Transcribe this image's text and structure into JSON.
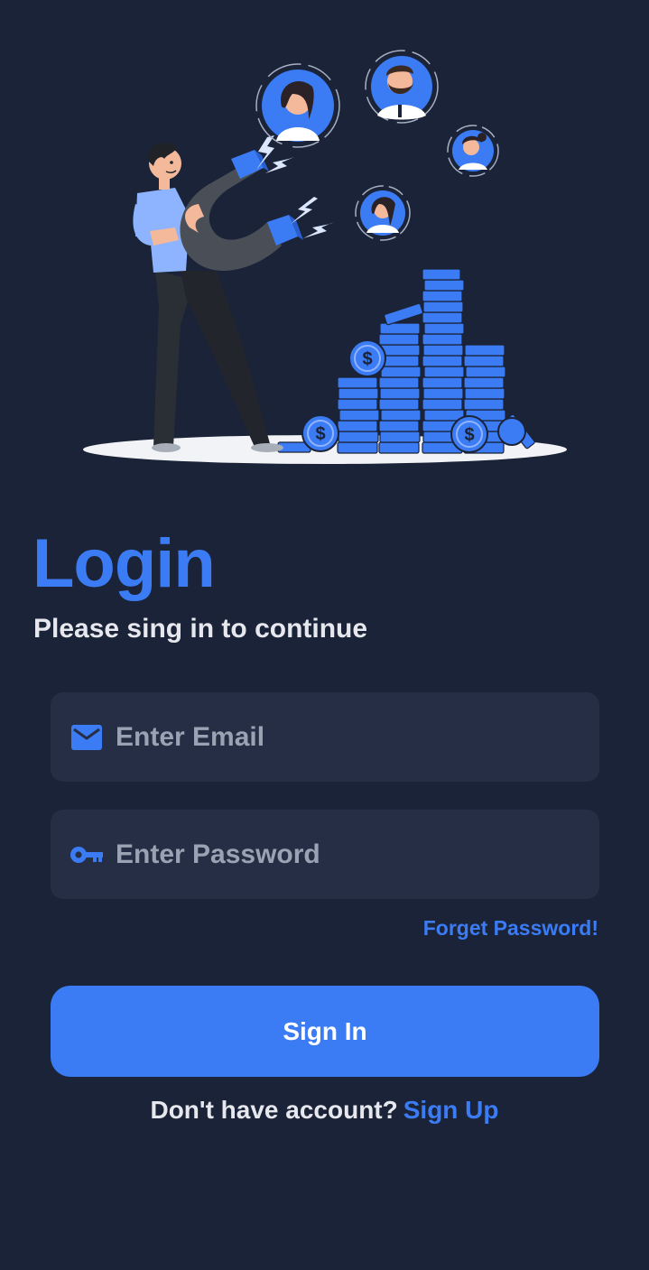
{
  "login": {
    "title": "Login",
    "subtitle": "Please sing in to continue"
  },
  "form": {
    "email": {
      "icon": "envelope-icon",
      "value": "",
      "placeholder": "Enter Email"
    },
    "password": {
      "icon": "key-icon",
      "value": "",
      "placeholder": "Enter Password"
    },
    "forgot_label": "Forget Password!",
    "submit_label": "Sign In"
  },
  "signup": {
    "prompt": "Don't have account?",
    "link_label": "Sign Up"
  },
  "colors": {
    "background": "#1b2338",
    "field_background": "#262e45",
    "accent": "#3b7cf5",
    "text_primary": "#e6e8ee",
    "placeholder": "#9aa3b4"
  }
}
